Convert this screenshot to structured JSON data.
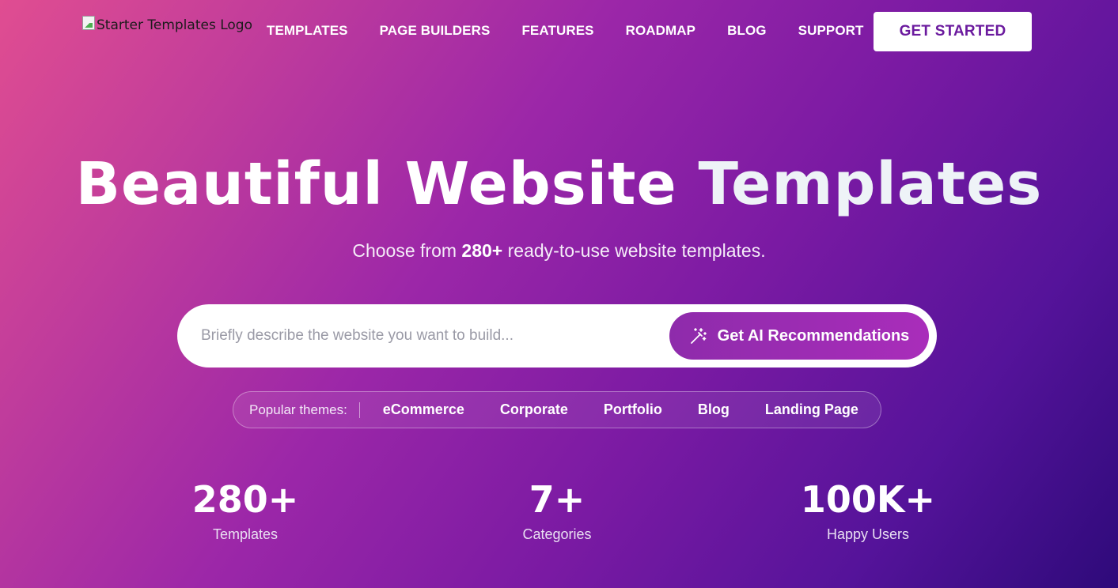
{
  "header": {
    "logo_alt": "Starter Templates Logo",
    "nav": [
      "TEMPLATES",
      "PAGE BUILDERS",
      "FEATURES",
      "ROADMAP",
      "BLOG",
      "SUPPORT"
    ],
    "cta_label": "GET STARTED"
  },
  "hero": {
    "title_main": "Beautiful Website",
    "title_tail": "Templates",
    "subtitle_pre": "Choose from",
    "subtitle_bold": "280+",
    "subtitle_post": "ready-to-use website templates."
  },
  "search": {
    "placeholder": "Briefly describe the website you want to build...",
    "value": "",
    "button_label": "Get AI Recommendations",
    "button_icon": "magic-wand-icon"
  },
  "themes": {
    "label": "Popular themes:",
    "items": [
      "eCommerce",
      "Corporate",
      "Portfolio",
      "Blog",
      "Landing Page"
    ]
  },
  "stats": [
    {
      "value": "280+",
      "label": "Templates"
    },
    {
      "value": "7+",
      "label": "Categories"
    },
    {
      "value": "100K+",
      "label": "Happy Users"
    }
  ],
  "colors": {
    "gradient_start": "#e04d91",
    "gradient_mid": "#9c27a8",
    "gradient_end": "#2e0a7a",
    "cta_text": "#6b1a9e",
    "ai_button": "#9a2cb2"
  }
}
